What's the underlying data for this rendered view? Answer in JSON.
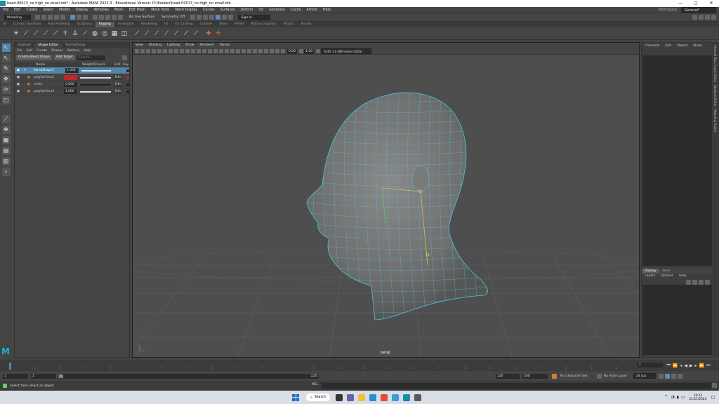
{
  "title": "head.00013_no high_no small.mb* - Autodesk MAYA 2022.3 - Educational Version: D:\\Backen\\head.00013_no high_no small.mb",
  "window_buttons": [
    "—",
    "▢",
    "✕"
  ],
  "workspace_label": "Workspace:",
  "workspace_value": "General*",
  "menubar": [
    "File",
    "Edit",
    "Create",
    "Select",
    "Modify",
    "Display",
    "Windows",
    "Mesh",
    "Edit Mesh",
    "Mesh Tools",
    "Mesh Display",
    "Curves",
    "Surfaces",
    "Deform",
    "UV",
    "Generate",
    "Cache",
    "Arnold",
    "Help"
  ],
  "statusline": {
    "mode": "Modeling",
    "live_surface": "No Live Surface",
    "symmetry": "Symmetry: Off",
    "sign_in": "Sign In"
  },
  "shelf_tabs": [
    "Curves / Surfaces",
    "Poly Modeling",
    "Sculpting",
    "Rigging",
    "Animation",
    "Rendering",
    "FX",
    "FX Caching",
    "Custom",
    "XGen",
    "MASH",
    "Motion Graphics",
    "Bifrost",
    "Arnold"
  ],
  "shelf_active": "Rigging",
  "shape_editor": {
    "tabs": [
      "Outliner",
      "Shape Editor",
      "Tool Settings"
    ],
    "active_tab": "Shape Editor",
    "menu": [
      "File",
      "Edit",
      "Create",
      "Shapes",
      "Options",
      "Help"
    ],
    "create_button": "Create Blend Shape",
    "add_target_button": "Add Target",
    "search_placeholder": "Search...",
    "headers": [
      "Name",
      "Weight/Drivers",
      "Edit",
      "Key"
    ],
    "rows": [
      {
        "name": "blendShape1",
        "weight": "1.000",
        "fill": 1.0,
        "edit": "",
        "selected": true,
        "key": "black"
      },
      {
        "name": "polySurface2",
        "weight": "1.000",
        "fill": 1.0,
        "edit": "Edit",
        "selected": false,
        "key": "red",
        "red": true
      },
      {
        "name": "smile",
        "weight": "0.000",
        "fill": 0.0,
        "edit": "Edit",
        "selected": false,
        "key": "black"
      },
      {
        "name": "polySurface3",
        "weight": "1.000",
        "fill": 1.0,
        "edit": "Edit",
        "selected": false,
        "key": "black"
      }
    ]
  },
  "viewport": {
    "menu": [
      "View",
      "Shading",
      "Lighting",
      "Show",
      "Renderer",
      "Panels"
    ],
    "field1": "0.00",
    "field2": "1.00",
    "colorspace": "ACES 1.0 SDR-video (ACES)",
    "camera_label": "persp"
  },
  "channel_box": {
    "menu": [
      "Channels",
      "Edit",
      "Object",
      "Show"
    ]
  },
  "layers": {
    "tabs": [
      "Display",
      "Anim"
    ],
    "menu": [
      "Layers",
      "Options",
      "Help"
    ]
  },
  "side_tabs": [
    "Channel Box / Layer Editor",
    "Attribute Editor",
    "Modeling Toolkit"
  ],
  "timeline": {
    "start_field": "1",
    "frame": "1"
  },
  "range": {
    "start": "1",
    "inner_start": "1",
    "inner_end": "120",
    "end": "120",
    "end2": "200",
    "character_set": "No Character Set",
    "anim_layer": "No Anim Layer",
    "fps": "24 fps"
  },
  "command": {
    "help": "Select from select an object",
    "lang": "MEL"
  },
  "taskbar": {
    "search": "Search",
    "time": "16:32",
    "date": "21/11/2022"
  },
  "colors": {
    "selection": "#5285a6",
    "wireframe": "#4fc7e0",
    "red": "#c0282d"
  }
}
